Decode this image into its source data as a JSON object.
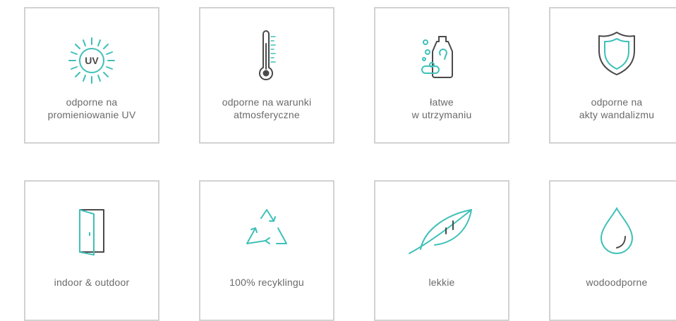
{
  "colors": {
    "accent": "#3fc0b8",
    "dark": "#4a4a4a",
    "border": "#d2d2d2",
    "text": "#6a6a6a"
  },
  "features": [
    {
      "icon": "uv-sun-icon",
      "uv_text": "UV",
      "lines": [
        "odporne na",
        "promieniowanie UV"
      ]
    },
    {
      "icon": "thermometer-icon",
      "lines": [
        "odporne na warunki",
        "atmosferyczne"
      ]
    },
    {
      "icon": "cleaning-bottle-icon",
      "lines": [
        "łatwe",
        "w utrzymaniu"
      ]
    },
    {
      "icon": "shield-icon",
      "lines": [
        "odporne na",
        "akty wandalizmu"
      ]
    },
    {
      "icon": "door-icon",
      "lines": [
        "indoor & outdoor"
      ]
    },
    {
      "icon": "recycle-icon",
      "lines": [
        "100% recyklingu"
      ]
    },
    {
      "icon": "feather-icon",
      "lines": [
        "lekkie"
      ]
    },
    {
      "icon": "water-drop-icon",
      "lines": [
        "wodoodporne"
      ]
    }
  ]
}
